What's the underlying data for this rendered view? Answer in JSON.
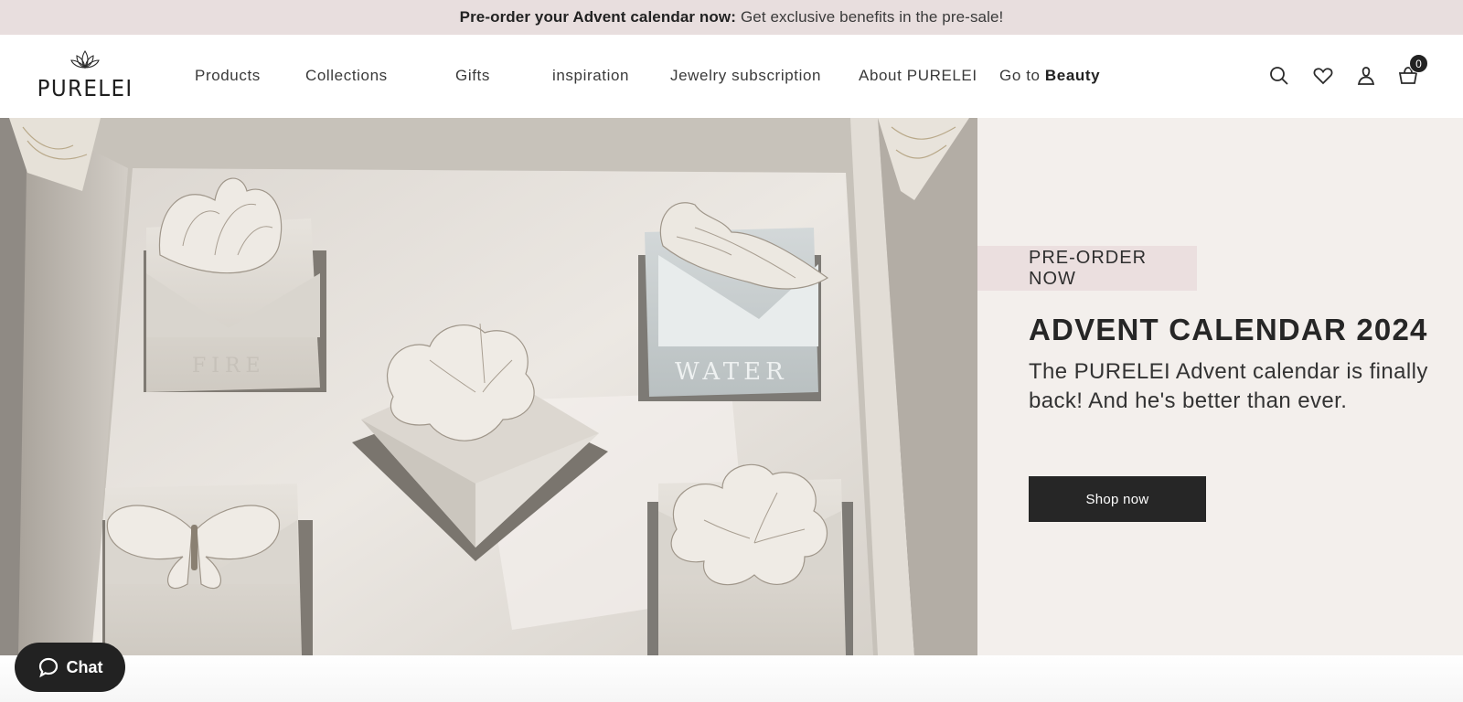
{
  "announcement": {
    "bold": "Pre-order your Advent calendar now:",
    "text": "Get exclusive benefits in the pre-sale!"
  },
  "header": {
    "logo_text": "PURELEI",
    "nav": [
      {
        "label": "Products"
      },
      {
        "label": "Collections"
      },
      {
        "label": "Gifts"
      },
      {
        "label": "inspiration"
      },
      {
        "label": "Jewelry subscription"
      },
      {
        "label": "About PURELEI"
      },
      {
        "label": "Go to",
        "bold": "Beauty"
      }
    ],
    "icons": [
      "search-icon",
      "heart-icon",
      "user-icon",
      "cart-icon"
    ],
    "cart_count": "0"
  },
  "hero": {
    "tag": "PRE-ORDER NOW",
    "title": "ADVENT CALENDAR 2024",
    "description": "The PURELEI Advent calendar is finally back! And he's better than ever.",
    "cta": "Shop now",
    "image_box_labels": [
      "FIRE",
      "WATER"
    ]
  },
  "chat": {
    "label": "Chat"
  },
  "colors": {
    "announce_bg": "#e8dede",
    "tag_bg": "#ebdfdf",
    "panel_bg": "#f3efec",
    "button_bg": "#262626"
  }
}
